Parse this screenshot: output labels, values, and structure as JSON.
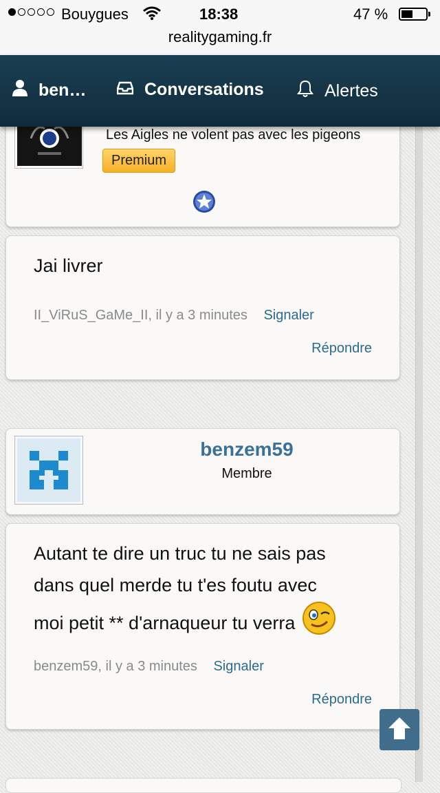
{
  "status_bar": {
    "carrier": "Bouygues",
    "time": "18:38",
    "battery_percent": "47 %",
    "signal_bars": 1,
    "battery_level": 0.47
  },
  "url_bar": {
    "domain": "realitygaming.fr"
  },
  "nav": {
    "user_label": "ben…",
    "conversations_label": "Conversations",
    "alerts_label": "Alertes"
  },
  "posts": {
    "top_profile": {
      "signature": "Les Aigles ne volent pas avec les pigeons",
      "badge": "Premium"
    },
    "post1": {
      "text": "Jai livrer",
      "meta": "II_ViRuS_GaMe_II, il y a 3 minutes",
      "report_label": "Signaler",
      "reply_label": "Répondre"
    },
    "profile2": {
      "username": "benzem59",
      "role": "Membre"
    },
    "post2": {
      "lines": [
        "Autant te dire un truc tu ne sais pas",
        "dans quel merde tu t'es foutu avec",
        "moi petit ** d'arnaqueur tu verra"
      ],
      "meta": "benzem59, il y a 3 minutes",
      "report_label": "Signaler",
      "reply_label": "Répondre"
    }
  },
  "colors": {
    "nav_bg": "#163647",
    "link": "#2c6a8f",
    "username": "#3b7199",
    "premium_badge": "#f6b024",
    "scroll_button": "#3f6d8b"
  }
}
